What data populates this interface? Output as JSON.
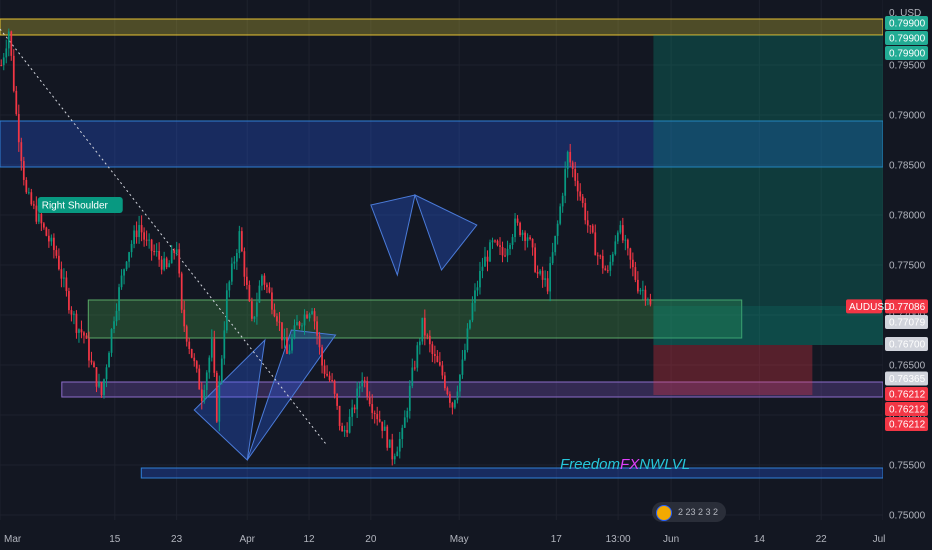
{
  "chart_data": {
    "type": "candlestick",
    "symbol": "AUDUSD",
    "currency_label": "0. USD",
    "ylim": [
      0.7495,
      0.8015
    ],
    "y_ticks": [
      "0.79500",
      "0.79000",
      "0.78500",
      "0.78000",
      "0.77500",
      "0.77000",
      "0.76500",
      "0.76000",
      "0.75500",
      "0.75000"
    ],
    "x_ticks": [
      {
        "label": "Mar",
        "x": 0
      },
      {
        "label": "15",
        "x": 13
      },
      {
        "label": "23",
        "x": 20
      },
      {
        "label": "Apr",
        "x": 28
      },
      {
        "label": "12",
        "x": 35
      },
      {
        "label": "20",
        "x": 42
      },
      {
        "label": "May",
        "x": 52
      },
      {
        "label": "17",
        "x": 63
      },
      {
        "label": "13:00",
        "x": 70
      },
      {
        "label": "Jun",
        "x": 76
      },
      {
        "label": "14",
        "x": 86
      },
      {
        "label": "22",
        "x": 93
      },
      {
        "label": "Jul",
        "x": 100
      }
    ],
    "price_tags": [
      {
        "value": "0.79900",
        "y": 0.7992,
        "color": "#22ab94",
        "text": "#ffffff"
      },
      {
        "value": "0.79900",
        "y": 0.7977,
        "color": "#22ab94",
        "text": "#ffffff"
      },
      {
        "value": "0.79900",
        "y": 0.7962,
        "color": "#22ab94",
        "text": "#ffffff"
      },
      {
        "value": "0.77086",
        "y": 0.77086,
        "color": "#f23645",
        "text": "#ffffff"
      },
      {
        "value": "0.77079",
        "y": 0.7693,
        "color": "#d1d4dc",
        "text": "#131722"
      },
      {
        "value": "0.76700",
        "y": 0.7671,
        "color": "#d1d4dc",
        "text": "#131722"
      },
      {
        "value": "0.76365",
        "y": 0.76365,
        "color": "#d1d4dc",
        "text": "#131722"
      },
      {
        "value": "0.76212",
        "y": 0.7621,
        "color": "#f23645",
        "text": "#ffffff"
      },
      {
        "value": "0.76212",
        "y": 0.7606,
        "color": "#f23645",
        "text": "#ffffff"
      },
      {
        "value": "0.76212",
        "y": 0.7591,
        "color": "#f23645",
        "text": "#ffffff"
      }
    ],
    "symbol_tag": {
      "value": "AUDUSD",
      "y": 0.77086
    },
    "annotations": [
      {
        "text": "Right Shoulder",
        "x": 4.5,
        "y": 0.781
      }
    ],
    "zones": [
      {
        "kind": "yellow",
        "x0": 0,
        "x1": 100,
        "y0": 0.798,
        "y1": 0.7996
      },
      {
        "kind": "blue",
        "x0": 0,
        "x1": 100,
        "y0": 0.7848,
        "y1": 0.7894
      },
      {
        "kind": "blue",
        "x0": 16,
        "x1": 100,
        "y0": 0.7537,
        "y1": 0.7547
      },
      {
        "kind": "green",
        "x0": 10,
        "x1": 84,
        "y0": 0.7677,
        "y1": 0.7715
      },
      {
        "kind": "purple",
        "x0": 7,
        "x1": 100,
        "y0": 0.7618,
        "y1": 0.7633
      },
      {
        "kind": "long",
        "x0": 74,
        "x1": 100,
        "y0": 0.7709,
        "y1": 0.798
      },
      {
        "kind": "longsmall",
        "x0": 74,
        "x1": 100,
        "y0": 0.767,
        "y1": 0.7709
      },
      {
        "kind": "short",
        "x0": 74,
        "x1": 92,
        "y0": 0.762,
        "y1": 0.767
      }
    ],
    "trend_line": {
      "x0": 0,
      "y0": 0.7986,
      "x1": 37,
      "y1": 0.757
    },
    "candles": {
      "count": 260,
      "seed": 7,
      "anchors": [
        [
          0,
          0.795
        ],
        [
          3,
          0.7985
        ],
        [
          6,
          0.79
        ],
        [
          10,
          0.782
        ],
        [
          16,
          0.779
        ],
        [
          22,
          0.776
        ],
        [
          26,
          0.772
        ],
        [
          30,
          0.769
        ],
        [
          33,
          0.768
        ],
        [
          36,
          0.765
        ],
        [
          40,
          0.762
        ],
        [
          45,
          0.77
        ],
        [
          50,
          0.776
        ],
        [
          55,
          0.779
        ],
        [
          58,
          0.777
        ],
        [
          62,
          0.776
        ],
        [
          66,
          0.7745
        ],
        [
          70,
          0.777
        ],
        [
          72,
          0.77
        ],
        [
          76,
          0.766
        ],
        [
          80,
          0.762
        ],
        [
          84,
          0.767
        ],
        [
          86,
          0.76
        ],
        [
          90,
          0.772
        ],
        [
          95,
          0.778
        ],
        [
          100,
          0.769
        ],
        [
          104,
          0.774
        ],
        [
          110,
          0.77
        ],
        [
          114,
          0.766
        ],
        [
          118,
          0.769
        ],
        [
          124,
          0.771
        ],
        [
          128,
          0.765
        ],
        [
          132,
          0.763
        ],
        [
          136,
          0.758
        ],
        [
          140,
          0.76
        ],
        [
          144,
          0.764
        ],
        [
          148,
          0.761
        ],
        [
          152,
          0.759
        ],
        [
          156,
          0.756
        ],
        [
          160,
          0.758
        ],
        [
          164,
          0.764
        ],
        [
          168,
          0.769
        ],
        [
          172,
          0.766
        ],
        [
          176,
          0.764
        ],
        [
          180,
          0.761
        ],
        [
          184,
          0.765
        ],
        [
          188,
          0.771
        ],
        [
          192,
          0.775
        ],
        [
          196,
          0.777
        ],
        [
          200,
          0.776
        ],
        [
          205,
          0.779
        ],
        [
          210,
          0.778
        ],
        [
          214,
          0.774
        ],
        [
          218,
          0.773
        ],
        [
          222,
          0.779
        ],
        [
          226,
          0.786
        ],
        [
          230,
          0.783
        ],
        [
          234,
          0.779
        ],
        [
          238,
          0.776
        ],
        [
          242,
          0.774
        ],
        [
          246,
          0.779
        ],
        [
          250,
          0.776
        ],
        [
          254,
          0.773
        ],
        [
          258,
          0.772
        ],
        [
          259,
          0.7708
        ]
      ]
    }
  },
  "watermark": {
    "part1": "Freedom",
    "part2": "FX",
    "part3": "NWLVL"
  },
  "footer_badge": "2 23 2 3 2"
}
